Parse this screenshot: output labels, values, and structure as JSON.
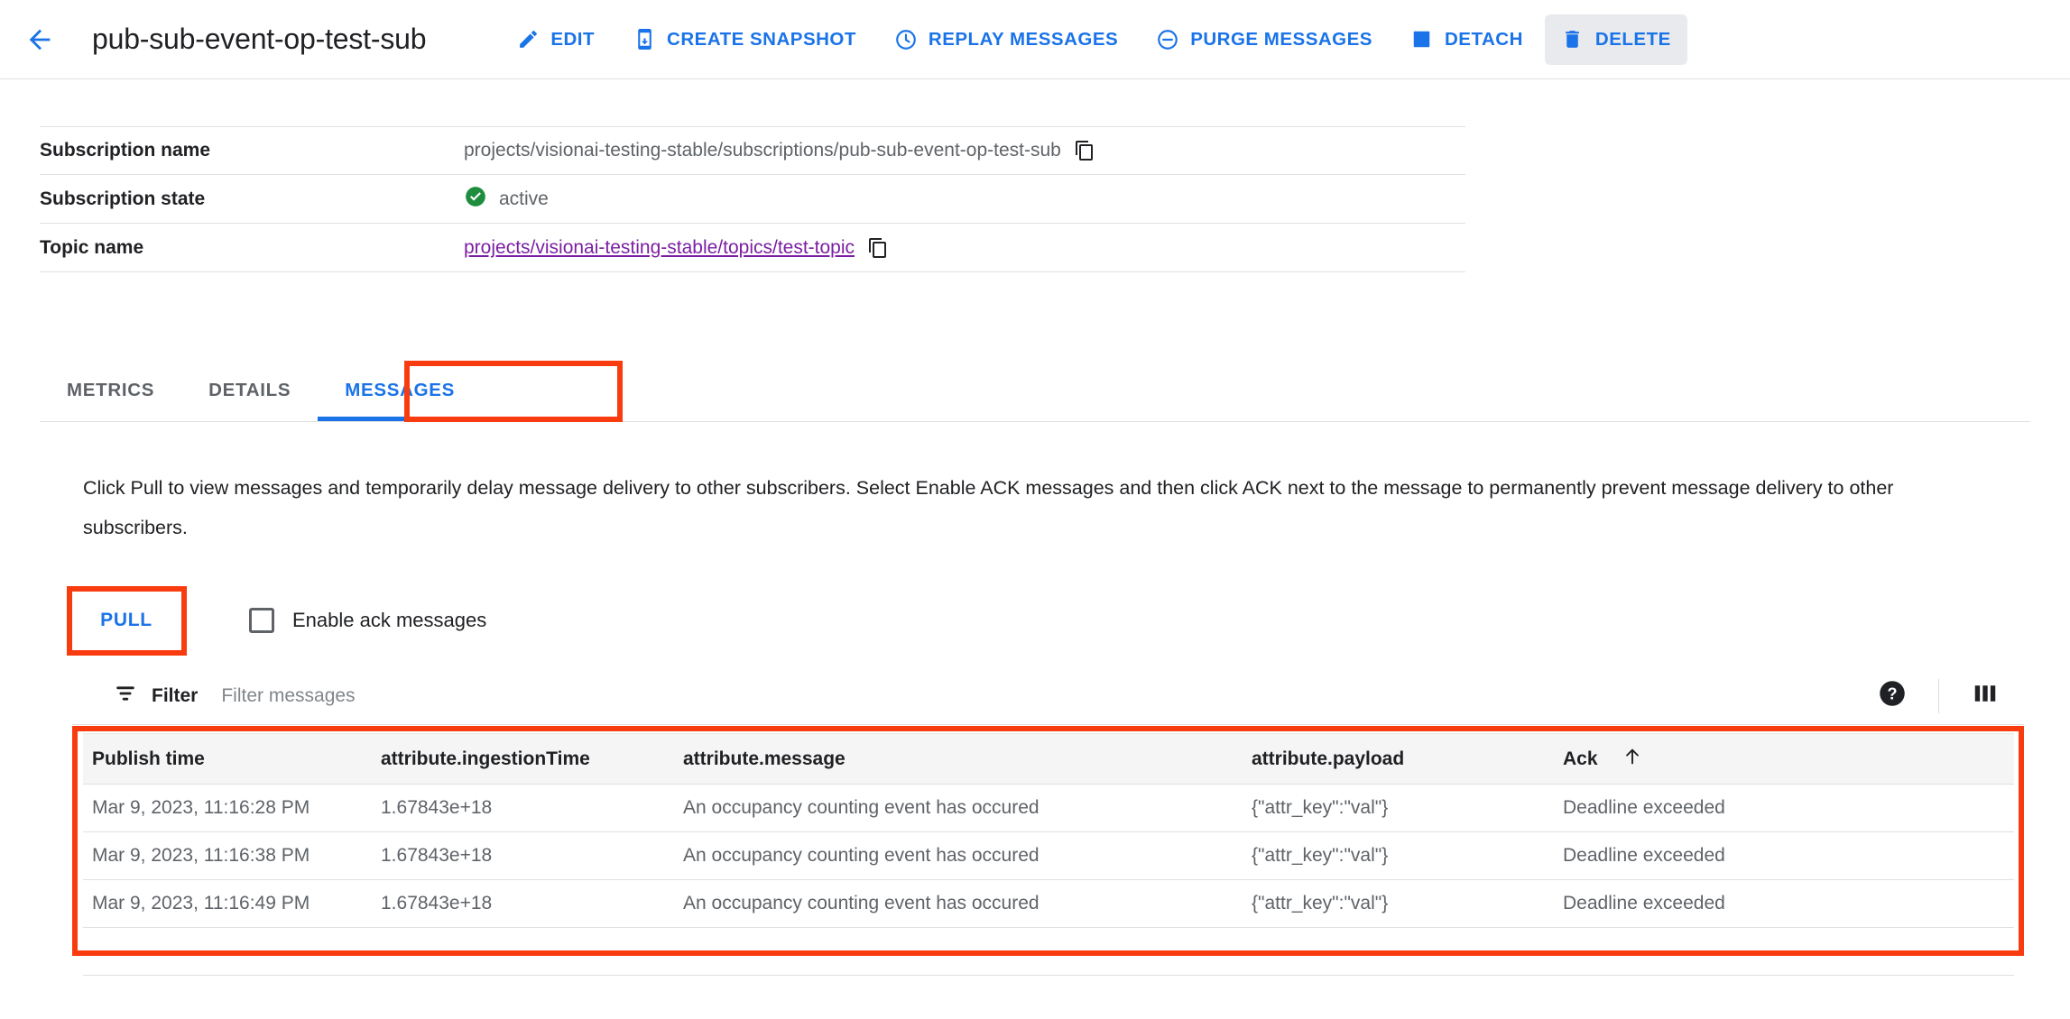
{
  "header": {
    "back_icon": "arrow-left-icon",
    "title": "pub-sub-event-op-test-sub",
    "actions": [
      {
        "label": "EDIT",
        "icon": "pencil-icon",
        "hovered": false
      },
      {
        "label": "CREATE SNAPSHOT",
        "icon": "snapshot-icon",
        "hovered": false
      },
      {
        "label": "REPLAY MESSAGES",
        "icon": "clock-icon",
        "hovered": false
      },
      {
        "label": "PURGE MESSAGES",
        "icon": "minus-circle-icon",
        "hovered": false
      },
      {
        "label": "DETACH",
        "icon": "detach-square-icon",
        "hovered": false
      },
      {
        "label": "DELETE",
        "icon": "trash-icon",
        "hovered": true
      }
    ]
  },
  "info": {
    "rows": [
      {
        "label": "Subscription name",
        "value": "projects/visionai-testing-stable/subscriptions/pub-sub-event-op-test-sub",
        "copy_icon": "copy-icon",
        "kind": "text-copy"
      },
      {
        "label": "Subscription state",
        "value": "active",
        "status_icon": "check-circle-icon",
        "kind": "status"
      },
      {
        "label": "Topic name",
        "value": "projects/visionai-testing-stable/topics/test-topic",
        "copy_icon": "copy-icon",
        "kind": "link-copy"
      }
    ]
  },
  "tabs": [
    {
      "label": "METRICS",
      "active": false
    },
    {
      "label": "DETAILS",
      "active": false
    },
    {
      "label": "MESSAGES",
      "active": true
    }
  ],
  "messages_panel": {
    "description": "Click Pull to view messages and temporarily delay message delivery to other subscribers. Select Enable ACK messages and then click ACK next to the message to permanently prevent message delivery to other subscribers.",
    "pull_label": "PULL",
    "ack_checkbox_label": "Enable ack messages",
    "ack_checkbox_checked": false,
    "filter": {
      "icon": "filter-icon",
      "label": "Filter",
      "placeholder": "Filter messages",
      "value": "",
      "help_icon": "help-circle-icon",
      "columns_icon": "column-display-icon"
    },
    "table": {
      "columns": [
        "Publish time",
        "attribute.ingestionTime",
        "attribute.message",
        "attribute.payload",
        "Ack"
      ],
      "sorted_column": "Ack",
      "sort_direction": "ascending",
      "sort_icon": "arrow-up-icon",
      "rows": [
        {
          "publish_time": "Mar 9, 2023, 11:16:28 PM",
          "ingestion_time": "1.67843e+18",
          "message": "An occupancy counting event has occured",
          "payload": "{\"attr_key\":\"val\"}",
          "ack": "Deadline exceeded"
        },
        {
          "publish_time": "Mar 9, 2023, 11:16:38 PM",
          "ingestion_time": "1.67843e+18",
          "message": "An occupancy counting event has occured",
          "payload": "{\"attr_key\":\"val\"}",
          "ack": "Deadline exceeded"
        },
        {
          "publish_time": "Mar 9, 2023, 11:16:49 PM",
          "ingestion_time": "1.67843e+18",
          "message": "An occupancy counting event has occured",
          "payload": "{\"attr_key\":\"val\"}",
          "ack": "Deadline exceeded"
        }
      ]
    }
  },
  "annotations": [
    {
      "name": "messages-tab-highlight",
      "color": "#f93b10"
    },
    {
      "name": "pull-button-highlight",
      "color": "#f93b10"
    },
    {
      "name": "messages-table-highlight",
      "color": "#f93b10"
    }
  ],
  "colors": {
    "accent_blue": "#1a73e8",
    "link_purple": "#7b1fa2",
    "status_green": "#1e8e3e",
    "annotation_red": "#f93b10",
    "text_primary": "#202124",
    "text_secondary": "#5f6368"
  }
}
